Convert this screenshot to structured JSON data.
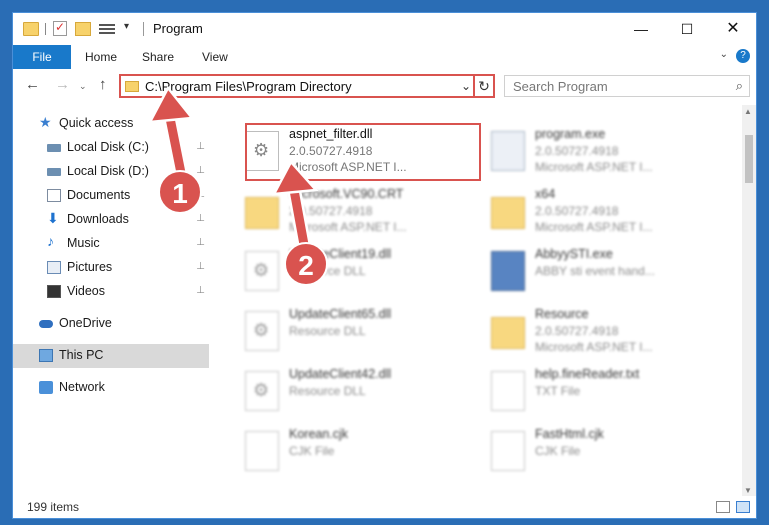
{
  "window": {
    "title": "Program",
    "minimize": "—",
    "maximize": "☐",
    "close": "✕"
  },
  "ribbon": {
    "tabs": [
      "File",
      "Home",
      "Share",
      "View"
    ],
    "expand": "⌄",
    "help": "?"
  },
  "address": {
    "path": "C:\\Program Files\\Program Directory",
    "chevron": "⌄",
    "refresh": "↻"
  },
  "search": {
    "placeholder": "Search Program",
    "icon": "⌕"
  },
  "nav": {
    "back": "←",
    "forward": "→",
    "recent": "⌄",
    "up": "↑"
  },
  "sidebar": {
    "items": [
      {
        "label": "Quick access",
        "icon": "star-icon"
      },
      {
        "label": "Local Disk (C:)",
        "icon": "drive-icon"
      },
      {
        "label": "Local Disk (D:)",
        "icon": "drive-icon"
      },
      {
        "label": "Documents",
        "icon": "documents-icon"
      },
      {
        "label": "Downloads",
        "icon": "download-icon"
      },
      {
        "label": "Music",
        "icon": "music-icon"
      },
      {
        "label": "Pictures",
        "icon": "pictures-icon"
      },
      {
        "label": "Videos",
        "icon": "videos-icon"
      },
      {
        "label": "OneDrive",
        "icon": "cloud-icon"
      },
      {
        "label": "This PC",
        "icon": "pc-icon"
      },
      {
        "label": "Network",
        "icon": "network-icon"
      }
    ],
    "pin": "⊥"
  },
  "files": [
    {
      "name": "aspnet_filter.dll",
      "line2": "2.0.50727.4918",
      "line3": "Microsoft ASP.NET I...",
      "icon": "dll-icon"
    },
    {
      "name": "program.exe",
      "line2": "2.0.50727.4918",
      "line3": "Microsoft ASP.NET I...",
      "icon": "exe-icon"
    },
    {
      "name": "Microsoft.VC90.CRT",
      "line2": "2.0.50727.4918",
      "line3": "Microsoft ASP.NET I...",
      "icon": "folder-icon"
    },
    {
      "name": "x64",
      "line2": "2.0.50727.4918",
      "line3": "Microsoft ASP.NET I...",
      "icon": "folder-icon"
    },
    {
      "name": "UpdateClient19.dll",
      "line2": "Resource DLL",
      "line3": "",
      "icon": "dll-icon"
    },
    {
      "name": "AbbyySTI.exe",
      "line2": "ABBY sti event hand...",
      "line3": "",
      "icon": "app-icon"
    },
    {
      "name": "UpdateClient65.dll",
      "line2": "Resource DLL",
      "line3": "",
      "icon": "dll-icon"
    },
    {
      "name": "Resource",
      "line2": "2.0.50727.4918",
      "line3": "Microsoft ASP.NET I...",
      "icon": "folder-icon"
    },
    {
      "name": "UpdateClient42.dll",
      "line2": "Resource DLL",
      "line3": "",
      "icon": "dll-icon"
    },
    {
      "name": "help.fineReader.txt",
      "line2": "TXT File",
      "line3": "",
      "icon": "txt-icon"
    },
    {
      "name": "Korean.cjk",
      "line2": "CJK File",
      "line3": "",
      "icon": "txt-icon"
    },
    {
      "name": "FastHtml.cjk",
      "line2": "CJK File",
      "line3": "",
      "icon": "txt-icon"
    }
  ],
  "status": {
    "count": "199 items"
  },
  "callouts": {
    "one": "1",
    "two": "2"
  },
  "colors": {
    "accent": "#1979ca",
    "highlight": "#d9534f",
    "desktop": "#2a6db5"
  }
}
